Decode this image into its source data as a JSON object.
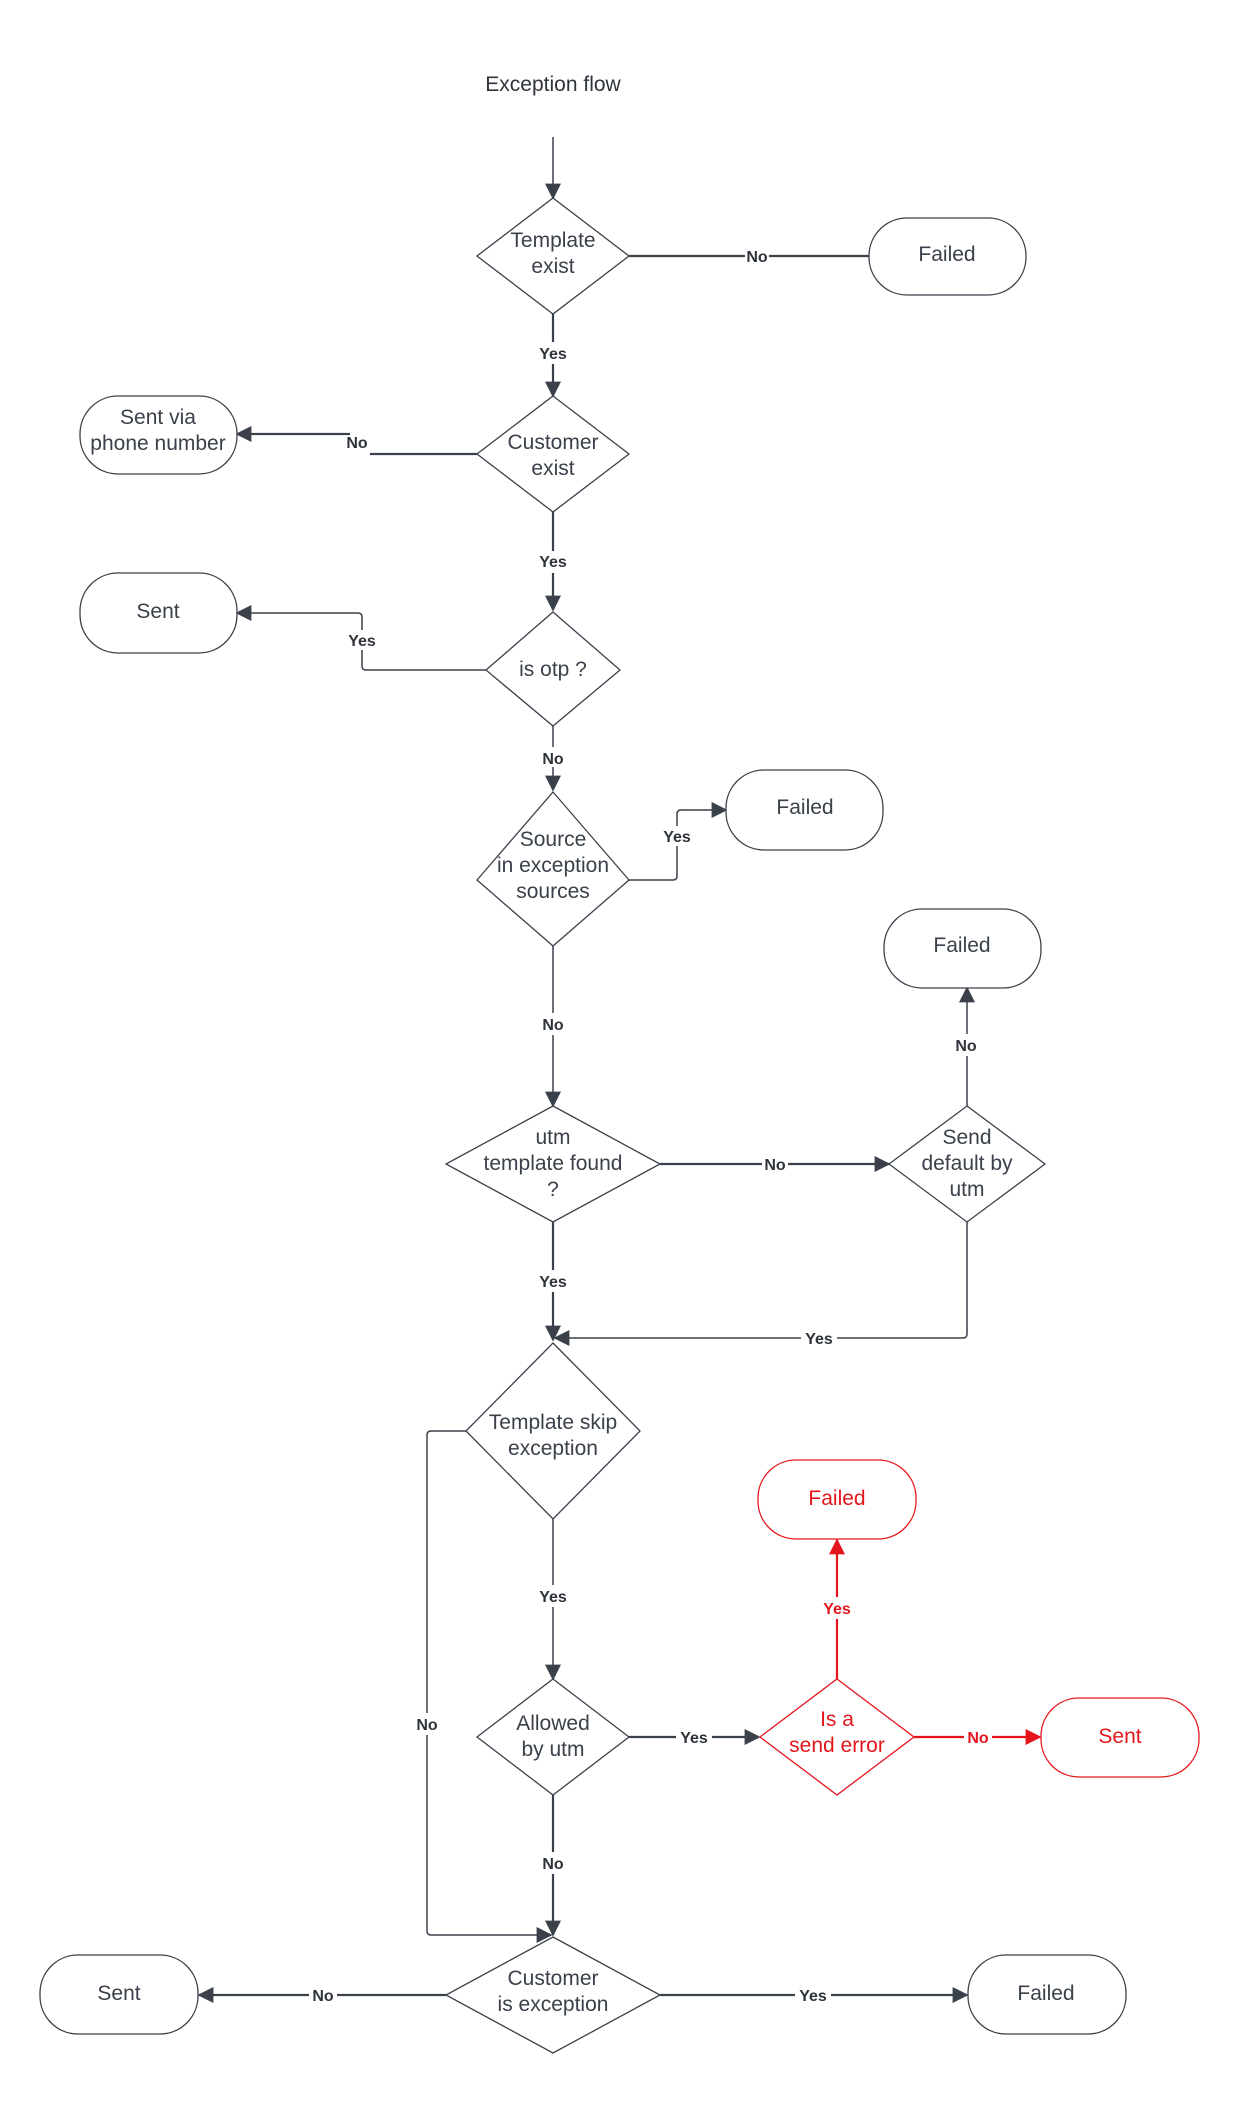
{
  "title": "Exception flow",
  "colors": {
    "stroke": "#3a414a",
    "text": "#3a414a",
    "highlight": "#e4161c",
    "background": "#ffffff"
  },
  "nodes": {
    "template_exist": {
      "type": "decision",
      "lines": [
        "Template",
        "exist"
      ]
    },
    "failed_template": {
      "type": "terminal",
      "lines": [
        "Failed"
      ]
    },
    "customer_exist": {
      "type": "decision",
      "lines": [
        "Customer",
        "exist"
      ]
    },
    "sent_via_phone": {
      "type": "terminal",
      "lines": [
        "Sent via",
        "phone number"
      ]
    },
    "is_otp": {
      "type": "decision",
      "lines": [
        "is otp ?"
      ]
    },
    "sent_otp": {
      "type": "terminal",
      "lines": [
        "Sent"
      ]
    },
    "source_in_exception": {
      "type": "decision",
      "lines": [
        "Source",
        "in exception",
        "sources"
      ]
    },
    "failed_source": {
      "type": "terminal",
      "lines": [
        "Failed"
      ]
    },
    "utm_template_found": {
      "type": "decision",
      "lines": [
        "utm",
        "template found",
        "?"
      ]
    },
    "send_default_by_utm": {
      "type": "decision",
      "lines": [
        "Send",
        "default by",
        "utm"
      ]
    },
    "failed_default": {
      "type": "terminal",
      "lines": [
        "Failed"
      ]
    },
    "template_skip_exception": {
      "type": "decision",
      "lines": [
        "Template skip",
        "exception"
      ]
    },
    "allowed_by_utm": {
      "type": "decision",
      "lines": [
        "Allowed",
        "by utm"
      ]
    },
    "is_send_error": {
      "type": "decision",
      "highlight": true,
      "lines": [
        "Is a",
        "send error"
      ]
    },
    "failed_send_error": {
      "type": "terminal",
      "highlight": true,
      "lines": [
        "Failed"
      ]
    },
    "sent_no_error": {
      "type": "terminal",
      "highlight": true,
      "lines": [
        "Sent"
      ]
    },
    "customer_is_exception": {
      "type": "decision",
      "lines": [
        "Customer",
        "is exception"
      ]
    },
    "sent_final": {
      "type": "terminal",
      "lines": [
        "Sent"
      ]
    },
    "failed_final": {
      "type": "terminal",
      "lines": [
        "Failed"
      ]
    }
  },
  "edges": [
    {
      "from": "start",
      "to": "template_exist",
      "label": ""
    },
    {
      "from": "template_exist",
      "to": "failed_template",
      "label": "No"
    },
    {
      "from": "template_exist",
      "to": "customer_exist",
      "label": "Yes"
    },
    {
      "from": "customer_exist",
      "to": "sent_via_phone",
      "label": "No"
    },
    {
      "from": "customer_exist",
      "to": "is_otp",
      "label": "Yes"
    },
    {
      "from": "is_otp",
      "to": "sent_otp",
      "label": "Yes"
    },
    {
      "from": "is_otp",
      "to": "source_in_exception",
      "label": "No"
    },
    {
      "from": "source_in_exception",
      "to": "failed_source",
      "label": "Yes"
    },
    {
      "from": "source_in_exception",
      "to": "utm_template_found",
      "label": "No"
    },
    {
      "from": "utm_template_found",
      "to": "send_default_by_utm",
      "label": "No"
    },
    {
      "from": "send_default_by_utm",
      "to": "failed_default",
      "label": "No"
    },
    {
      "from": "utm_template_found",
      "to": "template_skip_exception",
      "label": "Yes"
    },
    {
      "from": "send_default_by_utm",
      "to": "template_skip_exception",
      "label": "Yes"
    },
    {
      "from": "template_skip_exception",
      "to": "allowed_by_utm",
      "label": "Yes"
    },
    {
      "from": "template_skip_exception",
      "to": "customer_is_exception",
      "label": "No"
    },
    {
      "from": "allowed_by_utm",
      "to": "is_send_error",
      "label": "Yes"
    },
    {
      "from": "is_send_error",
      "to": "failed_send_error",
      "label": "Yes",
      "highlight": true
    },
    {
      "from": "is_send_error",
      "to": "sent_no_error",
      "label": "No",
      "highlight": true
    },
    {
      "from": "allowed_by_utm",
      "to": "customer_is_exception",
      "label": "No"
    },
    {
      "from": "customer_is_exception",
      "to": "sent_final",
      "label": "No"
    },
    {
      "from": "customer_is_exception",
      "to": "failed_final",
      "label": "Yes"
    }
  ]
}
